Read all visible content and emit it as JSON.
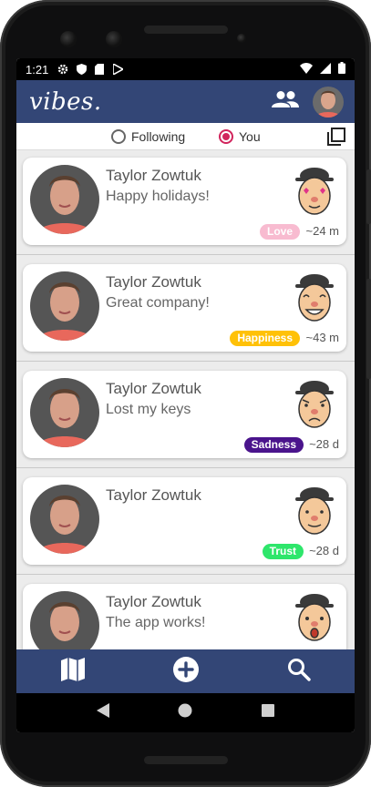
{
  "status_bar": {
    "time": "1:21",
    "icons": [
      "gear-icon",
      "shield-icon",
      "sd-card-icon",
      "play-store-icon"
    ],
    "right_icons": [
      "wifi-icon",
      "signal-icon",
      "battery-icon"
    ]
  },
  "app_bar": {
    "logo": "vibes.",
    "people_icon": "people-icon"
  },
  "filter": {
    "following_label": "Following",
    "you_label": "You",
    "selected": "You"
  },
  "colors": {
    "app_bar": "#334676",
    "radio_selected": "#d1245c",
    "love": "#f8bbd0",
    "happiness": "#ffc107",
    "sadness": "#4a148c",
    "trust": "#2ee66b"
  },
  "feed": [
    {
      "name": "Taylor Zowtuk",
      "message": "Happy holidays!",
      "emotion": "Love",
      "age": "~24 m",
      "badge_color": "#f8bbd0",
      "emoji": "love-emoji"
    },
    {
      "name": "Taylor Zowtuk",
      "message": "Great company!",
      "emotion": "Happiness",
      "age": "~43 m",
      "badge_color": "#ffc107",
      "emoji": "happy-emoji"
    },
    {
      "name": "Taylor Zowtuk",
      "message": "Lost my keys",
      "emotion": "Sadness",
      "age": "~28 d",
      "badge_color": "#4a148c",
      "emoji": "sad-emoji"
    },
    {
      "name": "Taylor Zowtuk",
      "message": "",
      "emotion": "Trust",
      "age": "~28 d",
      "badge_color": "#2ee66b",
      "emoji": "trust-emoji"
    },
    {
      "name": "Taylor Zowtuk",
      "message": "The app works!",
      "emotion": "",
      "age": "",
      "badge_color": "",
      "emoji": "surprise-emoji"
    }
  ],
  "bottom_nav": {
    "items": [
      "map-icon",
      "add-circle-icon",
      "search-icon"
    ]
  },
  "system_nav": {
    "items": [
      "back-icon",
      "home-icon",
      "recents-icon"
    ]
  }
}
